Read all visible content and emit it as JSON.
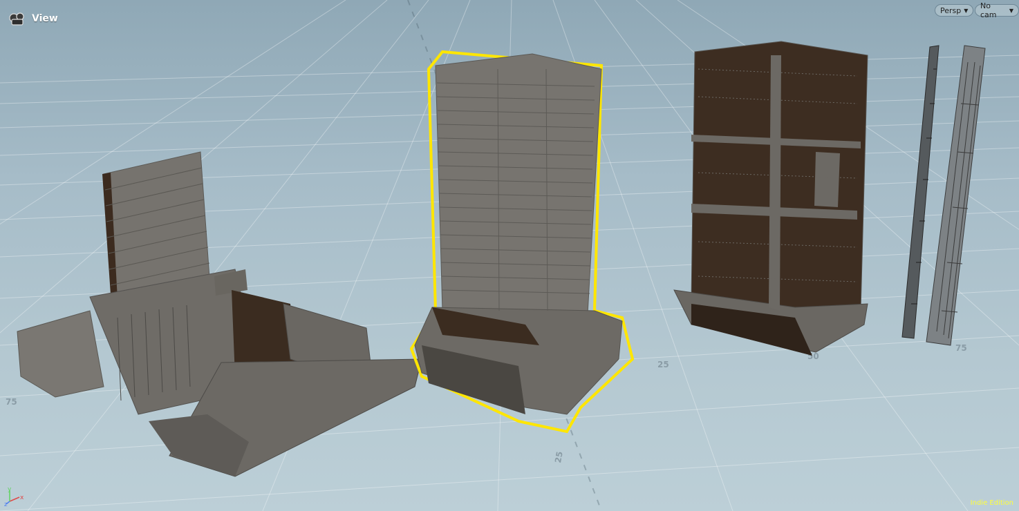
{
  "viewport": {
    "title": "View",
    "camera_mode": "Persp",
    "camera_select": "No cam",
    "edition": "Indie Edition",
    "colors": {
      "selection": "#ffe600",
      "building": "#6f6c67",
      "building_dark": "#3b2c20",
      "grid": "#ffffff"
    }
  },
  "grid": {
    "labels": [
      "25",
      "25",
      "50",
      "75",
      "75"
    ]
  },
  "axis": {
    "x": "x",
    "y": "y",
    "z": "z"
  },
  "icons": {
    "viewport": "viewport-camera-icon",
    "dropdown": "chevron-down-icon"
  }
}
